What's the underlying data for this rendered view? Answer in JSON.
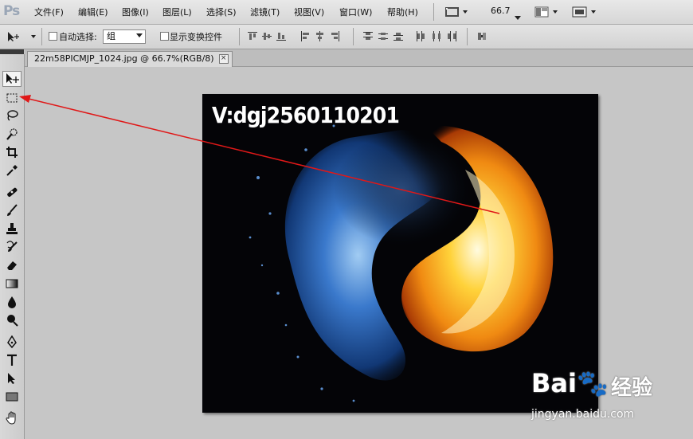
{
  "app": {
    "logo": "Ps"
  },
  "menubar": {
    "items": [
      "文件(F)",
      "编辑(E)",
      "图像(I)",
      "图层(L)",
      "选择(S)",
      "滤镜(T)",
      "视图(V)",
      "窗口(W)",
      "帮助(H)"
    ],
    "zoom": "66.7"
  },
  "options": {
    "auto_select_label": "自动选择:",
    "auto_select_value": "组",
    "show_transform_label": "显示变换控件"
  },
  "document": {
    "tab_title": "22m58PICMJP_1024.jpg @ 66.7%(RGB/8)",
    "tab_close": "×",
    "image_text": "V:dgj2560110201"
  },
  "watermark": {
    "word": "Bai🐾",
    "word2": "经验",
    "url": "jingyan.baidu.com"
  },
  "annotation": {
    "arrow_color": "#e01818"
  },
  "colors": {
    "menubar_bg": "#dcdcdc",
    "canvas_bg": "#c6c6c6",
    "doc_bg": "#040407"
  }
}
